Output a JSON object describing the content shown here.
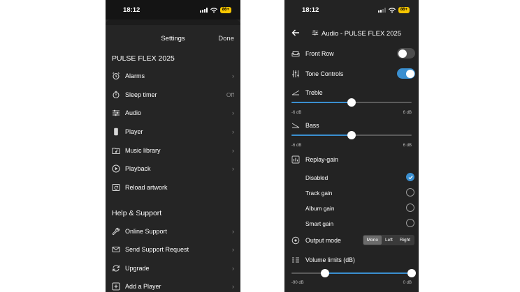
{
  "settings_screen": {
    "status": {
      "time": "18:12",
      "battery": "86+"
    },
    "title": "Settings",
    "done_label": "Done",
    "device_section": "PULSE FLEX 2025",
    "items": [
      {
        "label": "Alarms",
        "icon": "alarm-clock-icon",
        "chevron": "›"
      },
      {
        "label": "Sleep timer",
        "icon": "sleep-timer-icon",
        "value": "Off"
      },
      {
        "label": "Audio",
        "icon": "sliders-icon",
        "chevron": "›"
      },
      {
        "label": "Player",
        "icon": "speaker-icon",
        "chevron": "›"
      },
      {
        "label": "Music library",
        "icon": "music-library-icon",
        "chevron": "›"
      },
      {
        "label": "Playback",
        "icon": "play-circle-icon",
        "chevron": "›"
      },
      {
        "label": "Reload artwork",
        "icon": "reload-artwork-icon"
      }
    ],
    "help_section": "Help & Support",
    "help_items": [
      {
        "label": "Online Support",
        "icon": "wrench-icon",
        "chevron": "›"
      },
      {
        "label": "Send Support Request",
        "icon": "mail-icon",
        "chevron": "›"
      },
      {
        "label": "Upgrade",
        "icon": "refresh-icon",
        "chevron": "›"
      },
      {
        "label": "Add a Player",
        "icon": "add-icon",
        "chevron": "›"
      }
    ]
  },
  "audio_screen": {
    "status": {
      "time": "18:12",
      "battery": "86+"
    },
    "title": "Audio - PULSE FLEX 2025",
    "front_row": {
      "label": "Front Row",
      "on": false
    },
    "tone_controls": {
      "label": "Tone Controls",
      "on": true
    },
    "treble": {
      "label": "Treble",
      "min_label": "-6 dB",
      "max_label": "6 dB",
      "min": -6,
      "max": 6,
      "value": 0
    },
    "bass": {
      "label": "Bass",
      "min_label": "-6 dB",
      "max_label": "6 dB",
      "min": -6,
      "max": 6,
      "value": 0
    },
    "replay_gain": {
      "label": "Replay-gain",
      "options": [
        {
          "label": "Disabled",
          "checked": true
        },
        {
          "label": "Track gain",
          "checked": false
        },
        {
          "label": "Album gain",
          "checked": false
        },
        {
          "label": "Smart gain",
          "checked": false
        }
      ]
    },
    "output_mode": {
      "label": "Output mode",
      "options": [
        "Mono",
        "Left",
        "Right"
      ],
      "selected": "Mono"
    },
    "volume_limits": {
      "label": "Volume limits (dB)",
      "min_label": "-90 dB",
      "max_label": "0 dB",
      "min": -90,
      "max": 0,
      "low": -65,
      "high": 0
    },
    "accent_color": "#3a8fd0"
  }
}
